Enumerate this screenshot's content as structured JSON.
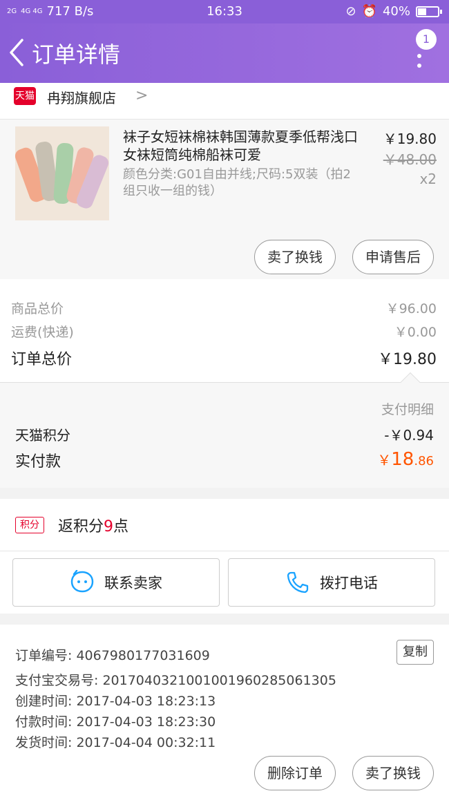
{
  "status_bar": {
    "signal_left": "2G",
    "signal_mid": "4G 4G",
    "speed": "717 B/s",
    "time": "16:33",
    "battery": "40%",
    "battery_level": 0.4
  },
  "navbar": {
    "title": "订单详情",
    "notification_count": "1"
  },
  "store": {
    "badge": "天猫",
    "name": "冉翔旗舰店"
  },
  "item": {
    "title": "袜子女短袜棉袜韩国薄款夏季低帮浅口女袜短筒纯棉船袜可爱",
    "spec": "颜色分类:G01自由并线;尺码:5双装（拍2组只收一组的钱）",
    "price": "￥19.80",
    "original_price": "￥48.00",
    "quantity": "x2",
    "btn_sell": "卖了换钱",
    "btn_after_sale": "申请售后"
  },
  "totals": {
    "goods_label": "商品总价",
    "goods_value": "￥96.00",
    "shipping_label": "运费(快递)",
    "shipping_value": "￥0.00",
    "order_label": "订单总价",
    "order_value": "￥19.80"
  },
  "payment": {
    "detail_label": "支付明细",
    "points_label": "天猫积分",
    "points_value": "-￥0.94",
    "paid_label": "实付款",
    "paid_currency": "￥",
    "paid_int": "18",
    "paid_dec": ".86"
  },
  "reward": {
    "tag": "积分",
    "prefix": "返积分",
    "points": "9",
    "suffix": "点"
  },
  "actions": {
    "contact_seller": "联系卖家",
    "call_phone": "拨打电话"
  },
  "info": {
    "order_no": "订单编号: 4067980177031609",
    "alipay_no": "支付宝交易号: 2017040321001001960285061305",
    "created": "创建时间: 2017-04-03 18:23:13",
    "paid": "付款时间: 2017-04-03 18:23:30",
    "shipped": "发货时间: 2017-04-04 00:32:11",
    "copy_label": "复制",
    "btn_delete": "删除订单",
    "btn_sell": "卖了换钱"
  },
  "colors": {
    "accent": "#8a5fd8",
    "price_orange": "#ff5500",
    "tmall_red": "#e4002b"
  }
}
